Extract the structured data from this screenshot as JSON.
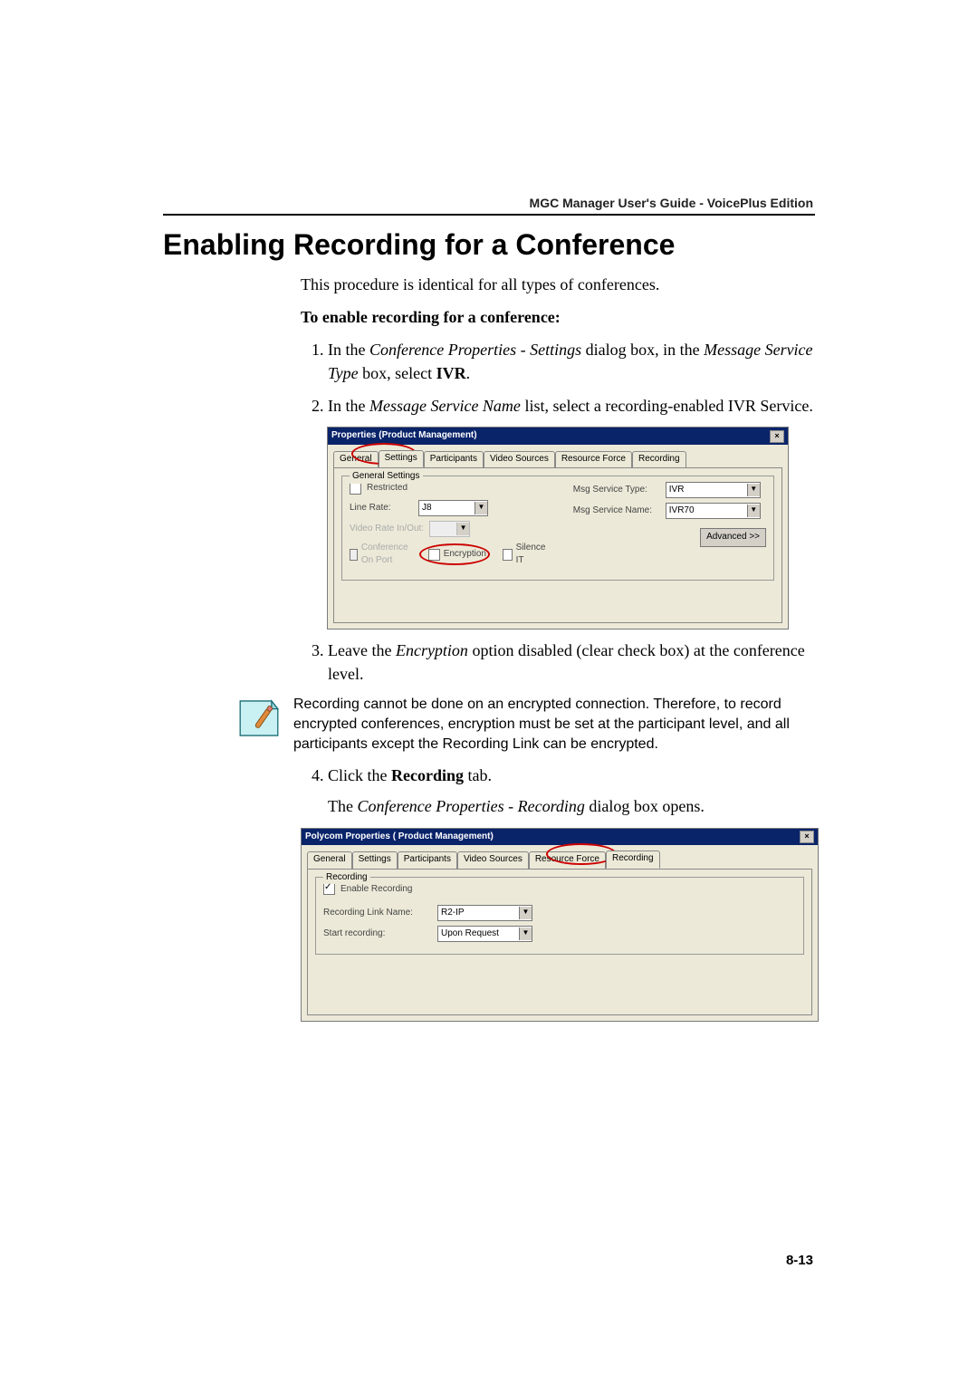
{
  "header": {
    "right": "MGC Manager User's Guide - VoicePlus Edition"
  },
  "title": "Enabling Recording for a Conference",
  "intro": "This procedure is identical for all types of conferences.",
  "procTitle": "To enable recording for a conference:",
  "step1": {
    "a": "In the ",
    "b": "Conference Properties - Settings",
    "c": " dialog box, in the ",
    "d": "Message Service Type",
    "e": " box, select ",
    "f": "IVR",
    "g": "."
  },
  "step2": {
    "a": "In the ",
    "b": "Message Service Name",
    "c": " list, select a recording-enabled IVR Service."
  },
  "step3": {
    "a": "Leave the ",
    "b": "Encryption",
    "c": " option disabled (clear check box) at the conference level."
  },
  "note": "Recording cannot be done on an encrypted connection. Therefore, to record encrypted conferences, encryption must be set at the participant level, and all participants except the Recording Link can be encrypted.",
  "step4": {
    "a": "Click the ",
    "b": "Recording",
    "c": " tab."
  },
  "step4after": {
    "a": "The ",
    "b": "Conference Properties - Recording",
    "c": " dialog box opens."
  },
  "dlg1": {
    "title": "Properties  (Product Management)",
    "tabs": [
      "General",
      "Settings",
      "Participants",
      "Video Sources",
      "Resource Force",
      "Recording"
    ],
    "group": "General Settings",
    "restricted": "Restricted",
    "lineRate": "Line Rate:",
    "lineRateVal": "J8",
    "videoRate": "Video Rate In/Out:",
    "confOnPort": "Conference On Port",
    "encryption": "Encryption",
    "silence": "Silence IT",
    "msgType": "Msg Service Type:",
    "msgTypeVal": "IVR",
    "msgName": "Msg Service Name:",
    "msgNameVal": "IVR70",
    "advanced": "Advanced >>"
  },
  "dlg2": {
    "title": "Polycom Properties  ( Product Management)",
    "tabs": [
      "General",
      "Settings",
      "Participants",
      "Video Sources",
      "Resource Force",
      "Recording"
    ],
    "group": "Recording",
    "enable": "Enable Recording",
    "linkName": "Recording Link Name:",
    "linkVal": "R2-IP",
    "start": "Start recording:",
    "startVal": "Upon Request"
  },
  "pageNum": "8-13"
}
